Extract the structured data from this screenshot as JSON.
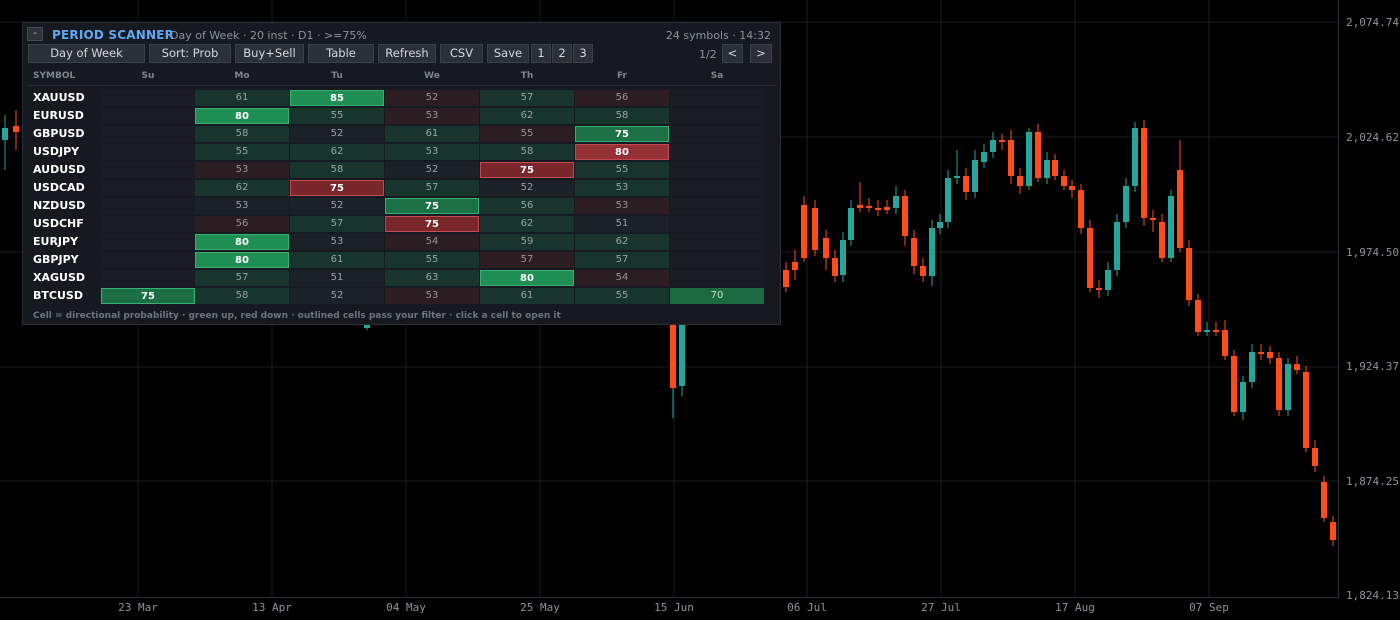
{
  "price_axis": {
    "labels": [
      "2,074.74",
      "2,024.62",
      "1,974.50",
      "1,924.37",
      "1,874.25",
      "1,824.13"
    ]
  },
  "time_axis": {
    "labels": [
      "23 Mar",
      "13 Apr",
      "04 May",
      "25 May",
      "15 Jun",
      "06 Jul",
      "27 Jul",
      "17 Aug",
      "07 Sep"
    ]
  },
  "colors": {
    "up": "#26a69a",
    "down": "#ff4d1a",
    "accent": "#5fa8f5",
    "strong_green": "#1e8e52",
    "strong_red": "#8a2a2f"
  },
  "scanner": {
    "collapse_icon": "-",
    "title": "PERIOD SCANNER",
    "subtitle": "Day of Week · 20 inst · D1 · >=75%",
    "meta": "24 symbols · 14:32",
    "buttons": [
      "Day of Week",
      "Sort: Prob",
      "Buy+Sell",
      "Table",
      "Refresh",
      "CSV",
      "Save",
      "1",
      "2",
      "3"
    ],
    "pager": {
      "label": "1/2",
      "prev": "<",
      "next": ">"
    },
    "columns": [
      "SYMBOL",
      "Su",
      "Mo",
      "Tu",
      "We",
      "Th",
      "Fr",
      "Sa"
    ],
    "rows": [
      {
        "symbol": "XAUUSD",
        "cells": [
          null,
          61,
          85,
          52,
          57,
          56,
          null
        ],
        "dirs": [
          "",
          "u",
          "u",
          "d",
          "u",
          "d",
          ""
        ]
      },
      {
        "symbol": "EURUSD",
        "cells": [
          null,
          80,
          55,
          53,
          62,
          58,
          null
        ],
        "dirs": [
          "",
          "u",
          "u",
          "d",
          "u",
          "u",
          ""
        ]
      },
      {
        "symbol": "GBPUSD",
        "cells": [
          null,
          58,
          52,
          61,
          55,
          75,
          null
        ],
        "dirs": [
          "",
          "u",
          "n",
          "u",
          "d",
          "u",
          ""
        ]
      },
      {
        "symbol": "USDJPY",
        "cells": [
          null,
          55,
          62,
          53,
          58,
          80,
          null
        ],
        "dirs": [
          "",
          "u",
          "u",
          "u",
          "u",
          "d",
          ""
        ]
      },
      {
        "symbol": "AUDUSD",
        "cells": [
          null,
          53,
          58,
          52,
          75,
          55,
          null
        ],
        "dirs": [
          "",
          "d",
          "u",
          "n",
          "d",
          "u",
          ""
        ]
      },
      {
        "symbol": "USDCAD",
        "cells": [
          null,
          62,
          75,
          57,
          52,
          53,
          null
        ],
        "dirs": [
          "",
          "u",
          "d",
          "u",
          "n",
          "u",
          ""
        ]
      },
      {
        "symbol": "NZDUSD",
        "cells": [
          null,
          53,
          52,
          75,
          56,
          53,
          null
        ],
        "dirs": [
          "",
          "n",
          "n",
          "u",
          "u",
          "d",
          ""
        ]
      },
      {
        "symbol": "USDCHF",
        "cells": [
          null,
          56,
          57,
          75,
          62,
          51,
          null
        ],
        "dirs": [
          "",
          "d",
          "u",
          "d",
          "u",
          "n",
          ""
        ]
      },
      {
        "symbol": "EURJPY",
        "cells": [
          null,
          80,
          53,
          54,
          59,
          62,
          null
        ],
        "dirs": [
          "",
          "u",
          "n",
          "d",
          "u",
          "u",
          ""
        ]
      },
      {
        "symbol": "GBPJPY",
        "cells": [
          null,
          80,
          61,
          55,
          57,
          57,
          null
        ],
        "dirs": [
          "",
          "u",
          "u",
          "u",
          "d",
          "u",
          ""
        ]
      },
      {
        "symbol": "XAGUSD",
        "cells": [
          null,
          57,
          51,
          63,
          80,
          54,
          null
        ],
        "dirs": [
          "",
          "u",
          "n",
          "u",
          "u",
          "d",
          ""
        ]
      },
      {
        "symbol": "BTCUSD",
        "cells": [
          75,
          58,
          52,
          53,
          61,
          55,
          70
        ],
        "dirs": [
          "u",
          "u",
          "n",
          "d",
          "u",
          "u",
          "u"
        ]
      }
    ],
    "footer": "Cell = directional probability · green up, red down · outlined cells pass your filter · click a cell to open it"
  }
}
